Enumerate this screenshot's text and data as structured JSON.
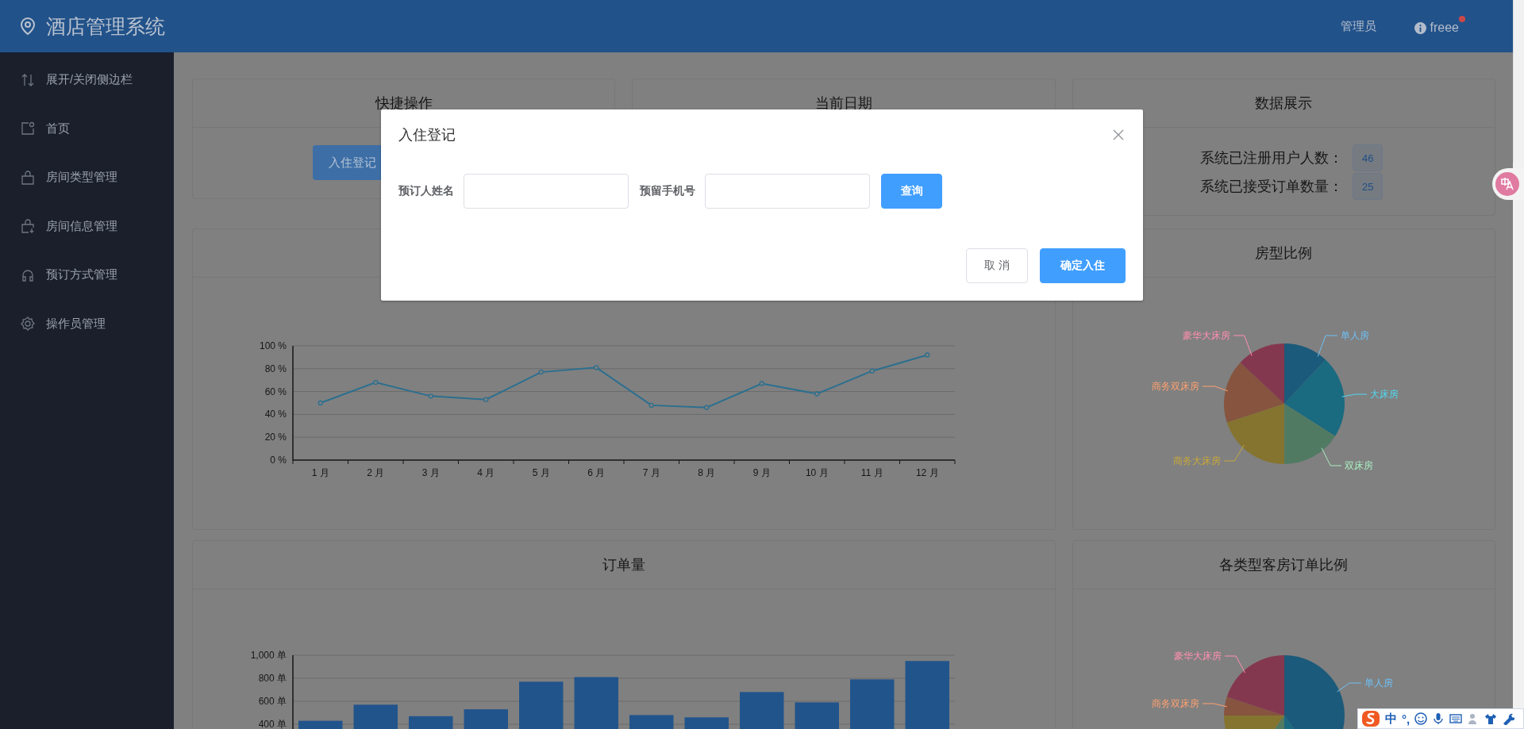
{
  "header": {
    "title": "酒店管理系统",
    "role": "管理员",
    "user": "freee",
    "notification": true
  },
  "sidebar": {
    "items": [
      {
        "label": "展开/关闭侧边栏",
        "kind": "toggle"
      },
      {
        "label": "首页",
        "kind": "home"
      },
      {
        "label": "房间类型管理",
        "kind": "bag"
      },
      {
        "label": "房间信息管理",
        "kind": "bag-in"
      },
      {
        "label": "预订方式管理",
        "kind": "headset"
      },
      {
        "label": "操作员管理",
        "kind": "gear"
      }
    ]
  },
  "quick_actions": {
    "title": "快捷操作",
    "buttons": [
      "入住登记"
    ]
  },
  "current_date": {
    "title": "当前日期"
  },
  "data_display": {
    "title": "数据展示",
    "stats": [
      {
        "label": "系统已注册用户人数：",
        "value": "46"
      },
      {
        "label": "系统已接受订单数量：",
        "value": "25"
      }
    ]
  },
  "occupancy_chart": {
    "chart_data": {
      "type": "line",
      "categories": [
        "1 月",
        "2 月",
        "3 月",
        "4 月",
        "5 月",
        "6 月",
        "7 月",
        "8 月",
        "9 月",
        "10 月",
        "11 月",
        "12 月"
      ],
      "series": [
        {
          "color": "#2b6f8f",
          "marker": "circle",
          "values": [
            50,
            68,
            56,
            53,
            77,
            81,
            48,
            46,
            67,
            58,
            78,
            92
          ]
        }
      ],
      "grid": true,
      "ylim": [
        0,
        100
      ],
      "yticks": [
        {
          "value": 0,
          "label": "0 %"
        },
        {
          "value": 20,
          "label": "20 %"
        },
        {
          "value": 40,
          "label": "40 %"
        },
        {
          "value": 60,
          "label": "60 %"
        },
        {
          "value": 80,
          "label": "80 %"
        },
        {
          "value": 100,
          "label": "100 %"
        }
      ]
    }
  },
  "room_type_ratio": {
    "title": "房型比例",
    "labels": [
      {
        "text": "豪华大床房",
        "color": "#ff8fb0"
      },
      {
        "text": "单人房",
        "color": "#6ec0f5"
      },
      {
        "text": "商务双床房",
        "color": "#ffa070"
      },
      {
        "text": "大床房",
        "color": "#50d8f0"
      },
      {
        "text": "商务大床房",
        "color": "#c8a838"
      },
      {
        "text": "双床房",
        "color": "#a8ecc0"
      }
    ]
  },
  "orders_chart": {
    "title": "订单量",
    "chart_data": {
      "type": "bar",
      "series": [
        {
          "color": "#22548c",
          "values": [
            430,
            570,
            470,
            530,
            770,
            810,
            480,
            460,
            680,
            590,
            790,
            950
          ]
        }
      ],
      "grid": true,
      "ylim": [
        0,
        1000
      ],
      "yticks": [
        {
          "value": 400,
          "label": "400 单"
        },
        {
          "value": 600,
          "label": "600 单"
        },
        {
          "value": 800,
          "label": "800 单"
        },
        {
          "value": 1000,
          "label": "1,000 单"
        }
      ]
    }
  },
  "order_ratio": {
    "title": "各类型客房订单比例",
    "labels": [
      {
        "text": "豪华大床房",
        "color": "#ff8fb0"
      },
      {
        "text": "单人房",
        "color": "#6ec0f5"
      },
      {
        "text": "商务双床房",
        "color": "#ffa070"
      }
    ]
  },
  "modal": {
    "title": "入住登记",
    "fields": [
      {
        "label": "预订人姓名"
      },
      {
        "label": "预留手机号"
      }
    ],
    "query_button": "查询",
    "cancel_button": "取 消",
    "confirm_button": "确定入住"
  },
  "ime_bar": {
    "mode": "中",
    "punctuation": "°,"
  }
}
